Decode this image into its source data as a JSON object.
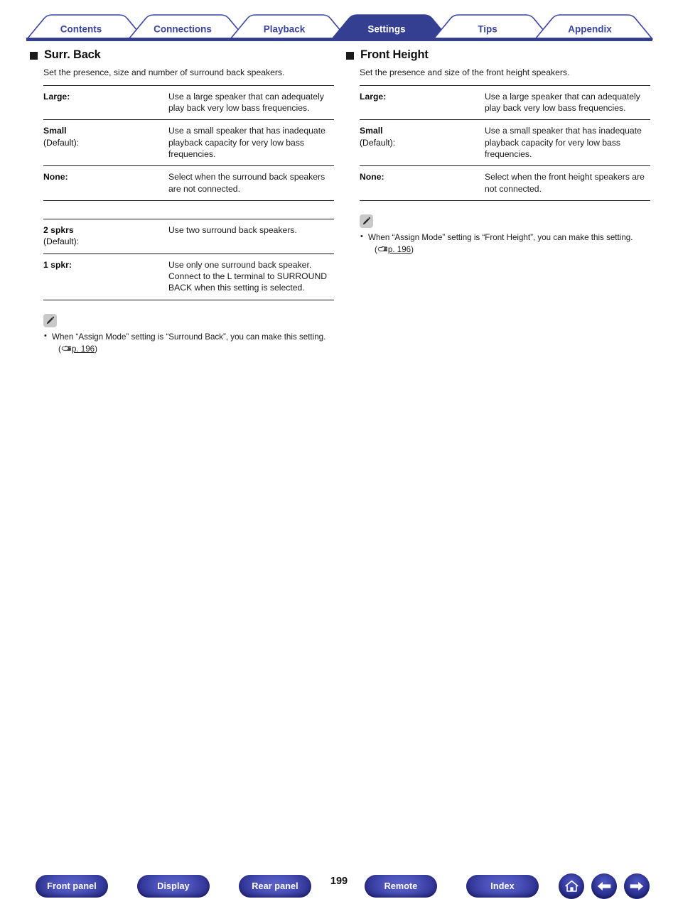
{
  "header": {
    "tabs": [
      {
        "label": "Contents",
        "active": false
      },
      {
        "label": "Connections",
        "active": false
      },
      {
        "label": "Playback",
        "active": false
      },
      {
        "label": "Settings",
        "active": true
      },
      {
        "label": "Tips",
        "active": false
      },
      {
        "label": "Appendix",
        "active": false
      }
    ],
    "accent_color": "#353f91",
    "active_tab_fill": "#353f91",
    "inactive_tab_text": "#3a45a0"
  },
  "left_column": {
    "section_title": "Surr. Back",
    "intro": "Set the presence, size and number of surround back speakers.",
    "table1": [
      {
        "term": "Large:",
        "term_sub": "",
        "desc": "Use a large speaker that can adequately play back very low bass frequencies."
      },
      {
        "term": "Small",
        "term_sub": "(Default):",
        "desc": "Use a small speaker that has inadequate playback capacity for very low bass frequencies."
      },
      {
        "term": "None:",
        "term_sub": "",
        "desc": "Select when the surround back speakers are not connected."
      }
    ],
    "table2": [
      {
        "term": "2 spkrs",
        "term_sub": "(Default):",
        "desc": "Use two surround back speakers."
      },
      {
        "term": "1 spkr:",
        "term_sub": "",
        "desc": "Use only one surround back speaker. Connect to the L terminal to SURROUND BACK when this setting is selected."
      }
    ],
    "note": {
      "icon": "pencil-icon",
      "text": "When “Assign Mode” setting is “Surround Back”, you can make this setting.",
      "ref_open": "(",
      "ref_icon": "pointing-hand-icon",
      "ref_link": "p. 196",
      "ref_close": ")"
    }
  },
  "right_column": {
    "section_title": "Front Height",
    "intro": "Set the presence and size of the front height speakers.",
    "table1": [
      {
        "term": "Large:",
        "term_sub": "",
        "desc": "Use a large speaker that can adequately play back very low bass frequencies."
      },
      {
        "term": "Small",
        "term_sub": "(Default):",
        "desc": "Use a small speaker that has inadequate playback capacity for very low bass frequencies."
      },
      {
        "term": "None:",
        "term_sub": "",
        "desc": "Select when the front height speakers are not connected."
      }
    ],
    "note": {
      "icon": "pencil-icon",
      "text": "When “Assign Mode” setting is “Front Height”, you can make this setting.",
      "ref_open": "(",
      "ref_icon": "pointing-hand-icon",
      "ref_link": "p. 196",
      "ref_close": ")"
    }
  },
  "footer": {
    "buttons": [
      {
        "label": "Front panel"
      },
      {
        "label": "Display"
      },
      {
        "label": "Rear panel"
      },
      {
        "label": "Remote"
      },
      {
        "label": "Index"
      }
    ],
    "page_number": "199",
    "icon_buttons": [
      {
        "name": "home-icon"
      },
      {
        "name": "back-arrow-icon"
      },
      {
        "name": "forward-arrow-icon"
      }
    ]
  }
}
